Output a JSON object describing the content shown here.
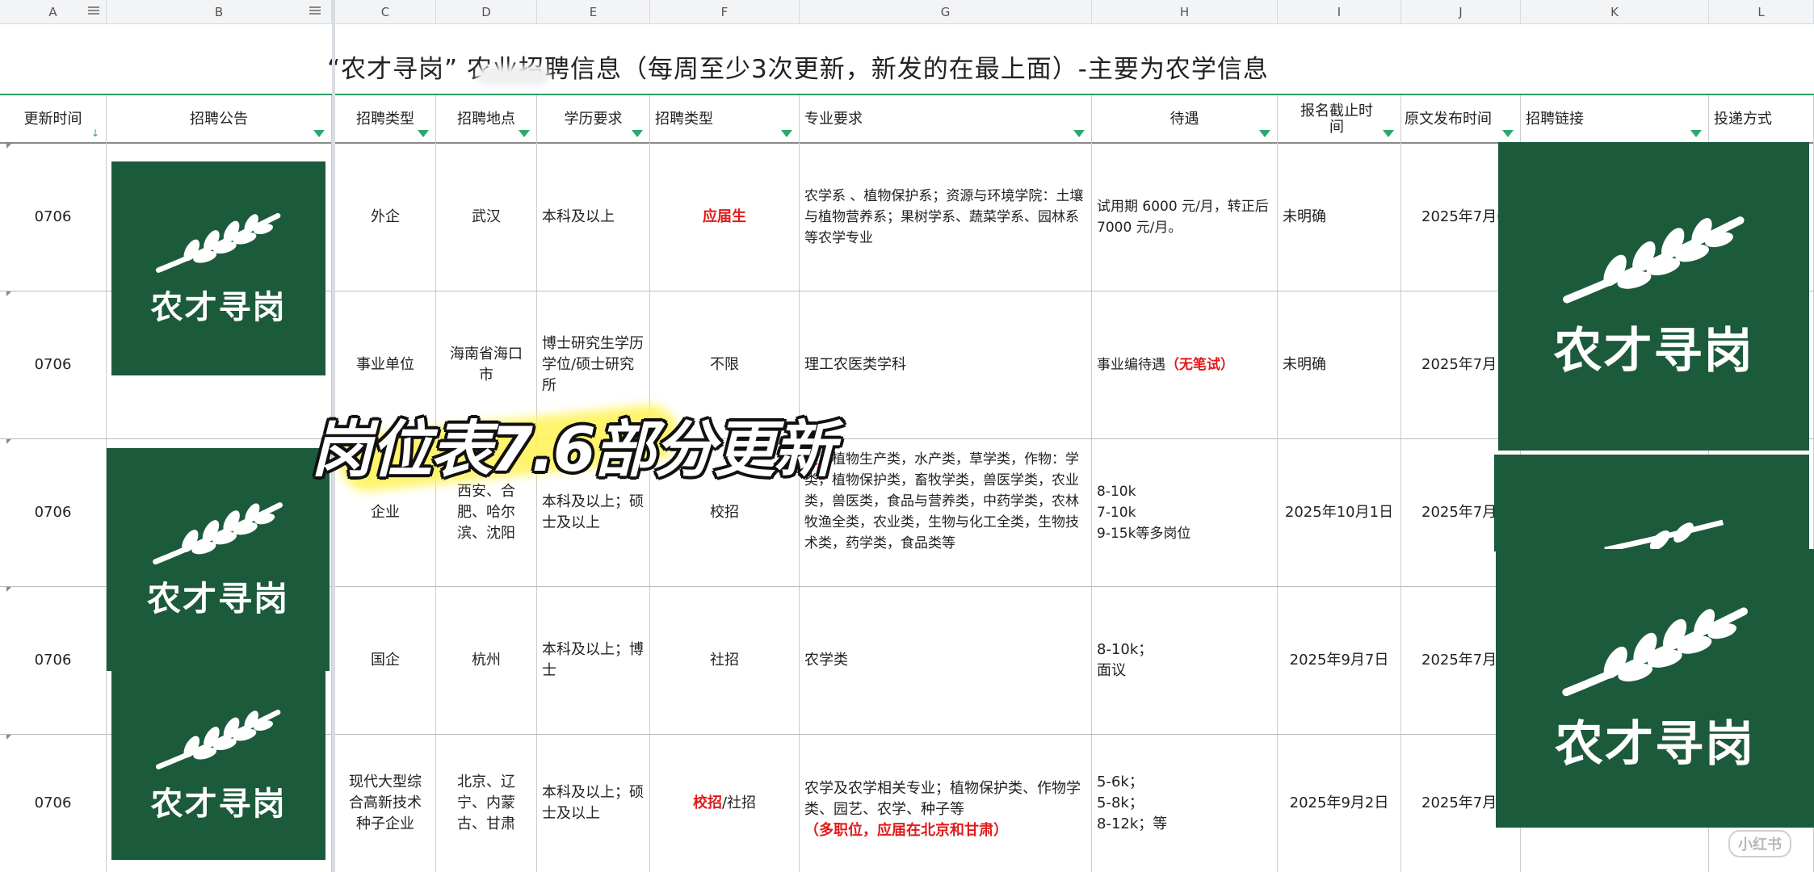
{
  "columns": [
    "A",
    "B",
    "C",
    "D",
    "E",
    "F",
    "G",
    "H",
    "I",
    "J",
    "K",
    "L"
  ],
  "title": "“农才寻岗”   农业招聘信息（每周至少3次更新，新发的在最上面）-主要为农学信息",
  "headers": {
    "update_time": "更新时间",
    "notice": "招聘公告",
    "rec_type": "招聘类型",
    "location": "招聘地点",
    "education": "学历要求",
    "rec_type2": "招聘类型",
    "major": "专业要求",
    "salary": "待遇",
    "deadline": "报名截止时间",
    "publish_time": "原文发布时间",
    "link": "招聘链接",
    "apply_method": "投递方式"
  },
  "rows": [
    {
      "update": "0706",
      "type": "外企",
      "location": "武汉",
      "education": "本科及以上",
      "rec_type2": "应届生",
      "major": "农学系 、植物保护系；资源与环境学院：土壤与植物营养系；果树学系、蔬菜学系、园林系等农学专业",
      "salary": "试用期 6000 元/月，转正后 7000 元/月。",
      "deadline": "未明确",
      "publish": "2025年7月6"
    },
    {
      "update": "0706",
      "type": "事业单位",
      "location": "海南省海口市",
      "education": "博士研究生学历学位/硕士研究所",
      "rec_type2": "不限",
      "major": "理工农医类学科",
      "salary_main": "事业编待遇",
      "salary_red": "（无笔试）",
      "deadline": "未明确",
      "publish": "2025年7月1"
    },
    {
      "update": "0706",
      "type": "企业",
      "location": "西安、合肥、哈尔滨、沈阳",
      "education": "本科及以上；硕士及以上",
      "rec_type2": "校招",
      "major_red": "类；",
      "major": "植物生产类，水产类，草学类，作物：学类，植物保护类，畜牧学类，兽医学类，农业类，兽医类，食品与营养类，中药学类，农林牧渔全类，农业类，生物与化工全类，生物技术类，药学类，食品类等",
      "salary": "8-10k\n7-10k\n9-15k等多岗位",
      "deadline": "2025年10月1日",
      "publish": "2025年7月"
    },
    {
      "update": "0706",
      "type": "国企",
      "location": "杭州",
      "education": "本科及以上；博士",
      "rec_type2": "社招",
      "major": "农学类",
      "salary": "8-10k；\n面议",
      "deadline": "2025年9月7日",
      "publish": "2025年7月"
    },
    {
      "update": "0706",
      "type": "现代大型综合高新技术种子企业",
      "location": "北京、辽宁、内蒙古、甘肃",
      "education": "本科及以上；硕士及以上",
      "rec_type2_red": "校招",
      "rec_type2_rest": "/社招",
      "major": "农学及农学相关专业；植物保护类、作物学类、园艺、农学、种子等",
      "major_red_line": "（多职位，应届在北京和甘肃）",
      "salary": "5-6k；\n5-8k；\n8-12k；等",
      "deadline": "2025年9月2日",
      "publish": "2025年7月"
    }
  ],
  "logo_text": "农才寻岗",
  "overlay": "岗位表7.6部分更新",
  "watermark": "小红书",
  "colors": {
    "logo_bg": "#1c5a3c",
    "accent_green": "#2aa86e",
    "red": "#e01b1b"
  }
}
